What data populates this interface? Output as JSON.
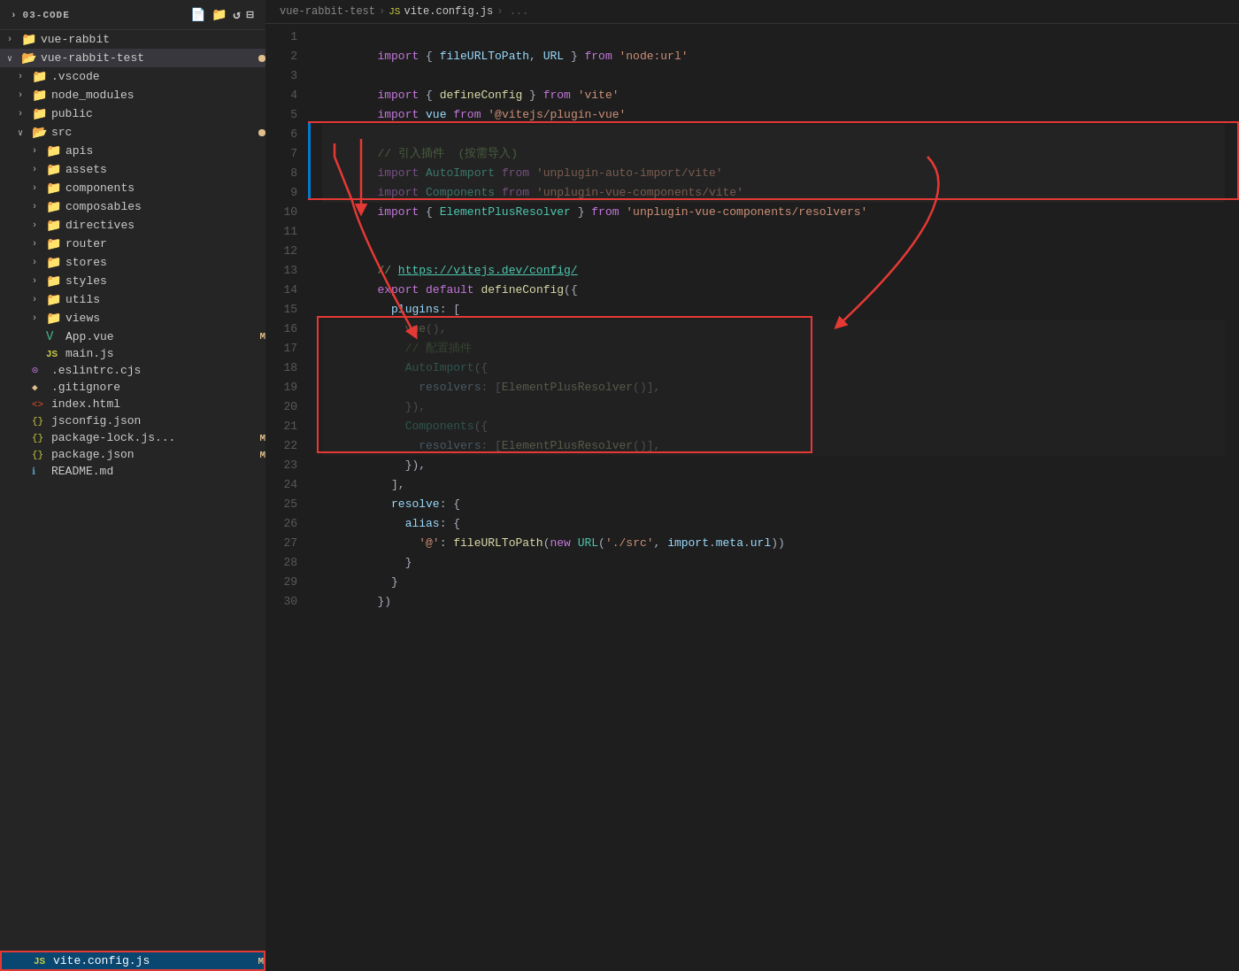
{
  "sidebar": {
    "title": "03-CODE",
    "items": [
      {
        "id": "vue-rabbit",
        "label": "vue-rabbit",
        "type": "folder",
        "indent": 0,
        "collapsed": true,
        "modified": false
      },
      {
        "id": "vue-rabbit-test",
        "label": "vue-rabbit-test",
        "type": "folder",
        "indent": 0,
        "collapsed": false,
        "modified": true
      },
      {
        "id": "vscode",
        "label": ".vscode",
        "type": "folder",
        "indent": 1,
        "collapsed": true,
        "modified": false
      },
      {
        "id": "node_modules",
        "label": "node_modules",
        "type": "folder",
        "indent": 1,
        "collapsed": true,
        "modified": false
      },
      {
        "id": "public",
        "label": "public",
        "type": "folder",
        "indent": 1,
        "collapsed": true,
        "modified": false
      },
      {
        "id": "src",
        "label": "src",
        "type": "folder",
        "indent": 1,
        "collapsed": false,
        "modified": true
      },
      {
        "id": "apis",
        "label": "apis",
        "type": "folder",
        "indent": 2,
        "collapsed": true,
        "modified": false
      },
      {
        "id": "assets",
        "label": "assets",
        "type": "folder",
        "indent": 2,
        "collapsed": true,
        "modified": false
      },
      {
        "id": "components",
        "label": "components",
        "type": "folder",
        "indent": 2,
        "collapsed": true,
        "modified": false
      },
      {
        "id": "composables",
        "label": "composables",
        "type": "folder",
        "indent": 2,
        "collapsed": true,
        "modified": false
      },
      {
        "id": "directives",
        "label": "directives",
        "type": "folder",
        "indent": 2,
        "collapsed": true,
        "modified": false
      },
      {
        "id": "router",
        "label": "router",
        "type": "folder",
        "indent": 2,
        "collapsed": true,
        "modified": false
      },
      {
        "id": "stores",
        "label": "stores",
        "type": "folder",
        "indent": 2,
        "collapsed": true,
        "modified": false
      },
      {
        "id": "styles",
        "label": "styles",
        "type": "folder",
        "indent": 2,
        "collapsed": true,
        "modified": false
      },
      {
        "id": "utils",
        "label": "utils",
        "type": "folder",
        "indent": 2,
        "collapsed": true,
        "modified": false
      },
      {
        "id": "views",
        "label": "views",
        "type": "folder",
        "indent": 2,
        "collapsed": true,
        "modified": false
      },
      {
        "id": "app-vue",
        "label": "App.vue",
        "type": "vue",
        "indent": 2,
        "collapsed": false,
        "modified": true
      },
      {
        "id": "main-js",
        "label": "main.js",
        "type": "js",
        "indent": 2,
        "collapsed": false,
        "modified": false
      },
      {
        "id": "eslintrc",
        "label": ".eslintrc.cjs",
        "type": "cjs",
        "indent": 1,
        "collapsed": false,
        "modified": false
      },
      {
        "id": "gitignore",
        "label": ".gitignore",
        "type": "git",
        "indent": 1,
        "collapsed": false,
        "modified": false
      },
      {
        "id": "index-html",
        "label": "index.html",
        "type": "html",
        "indent": 1,
        "collapsed": false,
        "modified": false
      },
      {
        "id": "jsconfig-json",
        "label": "jsconfig.json",
        "type": "json",
        "indent": 1,
        "collapsed": false,
        "modified": false
      },
      {
        "id": "package-lock",
        "label": "package-lock.js...",
        "type": "json",
        "indent": 1,
        "collapsed": false,
        "modified": true
      },
      {
        "id": "package-json",
        "label": "package.json",
        "type": "json",
        "indent": 1,
        "collapsed": false,
        "modified": true
      },
      {
        "id": "readme",
        "label": "README.md",
        "type": "md",
        "indent": 1,
        "collapsed": false,
        "modified": false
      },
      {
        "id": "vite-config",
        "label": "vite.config.js",
        "type": "js",
        "indent": 1,
        "collapsed": false,
        "modified": true,
        "active": true
      }
    ]
  },
  "breadcrumb": {
    "project": "vue-rabbit-test",
    "icon": "JS",
    "file": "vite.config.js",
    "extra": "..."
  },
  "code": {
    "lines": [
      {
        "num": 1,
        "content": "import { fileURLToPath, URL } from 'node:url'"
      },
      {
        "num": 2,
        "content": ""
      },
      {
        "num": 3,
        "content": "import { defineConfig } from 'vite'"
      },
      {
        "num": 4,
        "content": "import vue from '@vitejs/plugin-vue'"
      },
      {
        "num": 5,
        "content": ""
      },
      {
        "num": 6,
        "content": "// 引入插件  (按需导入)"
      },
      {
        "num": 7,
        "content": "import AutoImport from 'unplugin-auto-import/vite'"
      },
      {
        "num": 8,
        "content": "import Components from 'unplugin-vue-components/vite'"
      },
      {
        "num": 9,
        "content": "import { ElementPlusResolver } from 'unplugin-vue-components/resolvers'"
      },
      {
        "num": 10,
        "content": ""
      },
      {
        "num": 11,
        "content": ""
      },
      {
        "num": 12,
        "content": "// https://vitejs.dev/config/"
      },
      {
        "num": 13,
        "content": "export default defineConfig({"
      },
      {
        "num": 14,
        "content": "  plugins: ["
      },
      {
        "num": 15,
        "content": "    vue(),"
      },
      {
        "num": 16,
        "content": "    // 配置插件"
      },
      {
        "num": 17,
        "content": "    AutoImport({"
      },
      {
        "num": 18,
        "content": "      resolvers: [ElementPlusResolver()],"
      },
      {
        "num": 19,
        "content": "    }),"
      },
      {
        "num": 20,
        "content": "    Components({"
      },
      {
        "num": 21,
        "content": "      resolvers: [ElementPlusResolver()],"
      },
      {
        "num": 22,
        "content": "    }),"
      },
      {
        "num": 23,
        "content": "  ],"
      },
      {
        "num": 24,
        "content": "  resolve: {"
      },
      {
        "num": 25,
        "content": "    alias: {"
      },
      {
        "num": 26,
        "content": "      '@': fileURLToPath(new URL('./src', import.meta.url))"
      },
      {
        "num": 27,
        "content": "    }"
      },
      {
        "num": 28,
        "content": "  }"
      },
      {
        "num": 29,
        "content": "})"
      },
      {
        "num": 30,
        "content": ""
      }
    ]
  }
}
